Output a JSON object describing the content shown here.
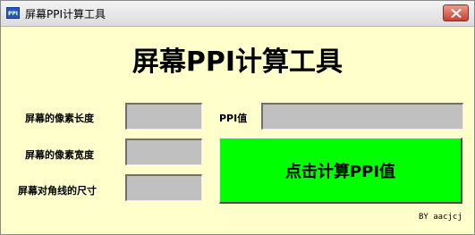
{
  "window": {
    "title": "屏幕PPI计算工具",
    "icon_label": "PPI",
    "icon": "app-icon",
    "close_icon": "close-icon"
  },
  "heading": "屏幕PPI计算工具",
  "form": {
    "width_label": "屏幕的像素长度",
    "width_value": "",
    "height_label": "屏幕的像素宽度",
    "height_value": "",
    "diagonal_label": "屏幕对角线的尺寸",
    "diagonal_value": "",
    "ppi_label": "PPI值",
    "ppi_value": ""
  },
  "calculate_button": "点击计算PPI值",
  "credit": "BY aacjcj",
  "colors": {
    "background": "#ffffcc",
    "button": "#00ff00",
    "field": "#c0c0c0",
    "close_button": "#c8412d"
  }
}
